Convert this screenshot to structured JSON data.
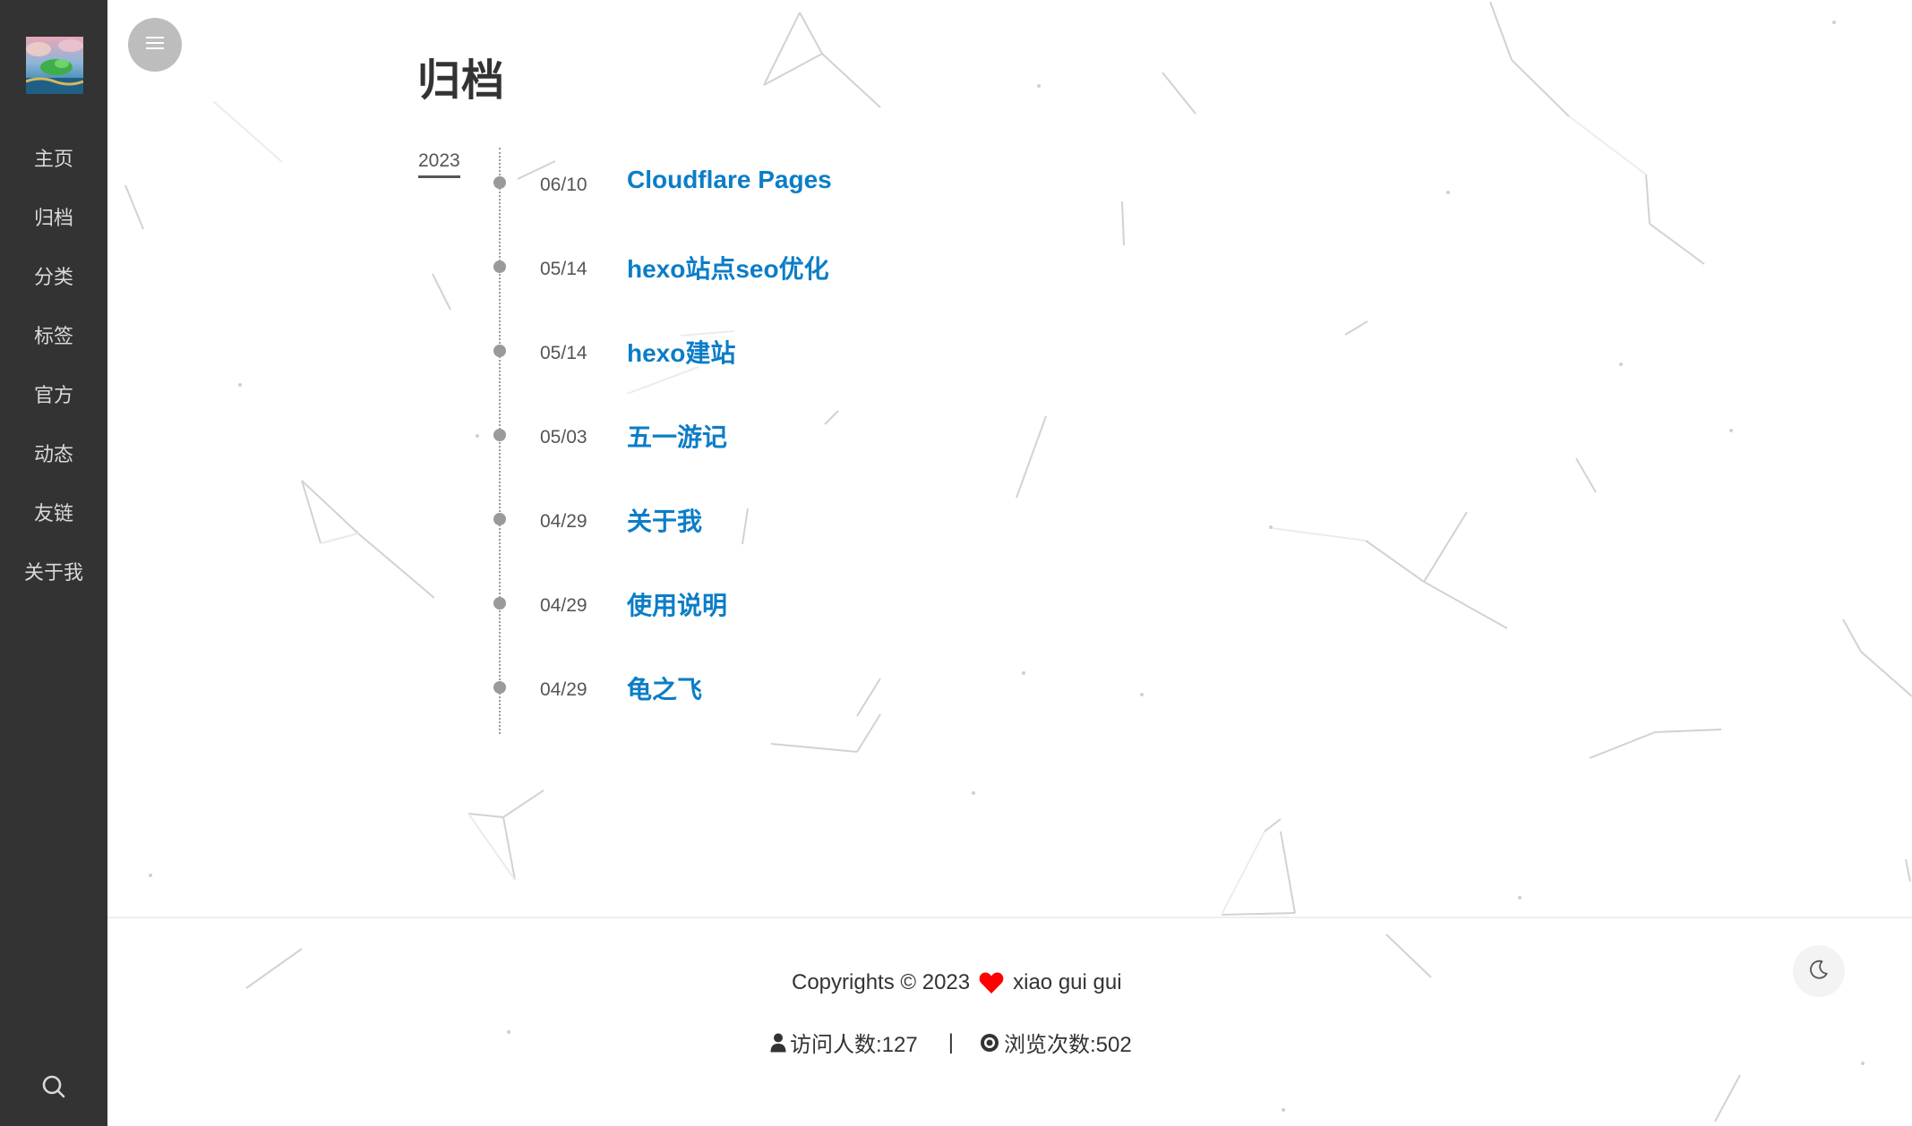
{
  "sidebar": {
    "avatar_icon": "avatar-image",
    "nav": [
      {
        "label": "主页"
      },
      {
        "label": "归档"
      },
      {
        "label": "分类"
      },
      {
        "label": "标签"
      },
      {
        "label": "官方"
      },
      {
        "label": "动态"
      },
      {
        "label": "友链"
      },
      {
        "label": "关于我"
      }
    ],
    "search_icon": "search-icon"
  },
  "header": {
    "menu_icon": "menu-icon"
  },
  "archive": {
    "title": "归档",
    "year": "2023",
    "posts": [
      {
        "date": "06/10",
        "title": "Cloudflare Pages"
      },
      {
        "date": "05/14",
        "title": "hexo站点seo优化"
      },
      {
        "date": "05/14",
        "title": "hexo建站"
      },
      {
        "date": "05/03",
        "title": "五一游记"
      },
      {
        "date": "04/29",
        "title": "关于我"
      },
      {
        "date": "04/29",
        "title": "使用说明"
      },
      {
        "date": "04/29",
        "title": "龟之飞"
      }
    ]
  },
  "footer": {
    "copyright_prefix": "Copyrights © 2023",
    "author": "xiao gui gui",
    "visitors": "访问人数:127",
    "separator": "|",
    "page_views": "浏览次数:502",
    "heart_icon": "heart-icon",
    "user_icon": "user-icon",
    "eye_icon": "eye-icon"
  },
  "theme_toggle_icon": "moon-icon",
  "colors": {
    "sidebar_bg": "#333333",
    "link": "#0b7dc7",
    "heart": "#ff0000",
    "timeline": "#9a9a9a"
  }
}
